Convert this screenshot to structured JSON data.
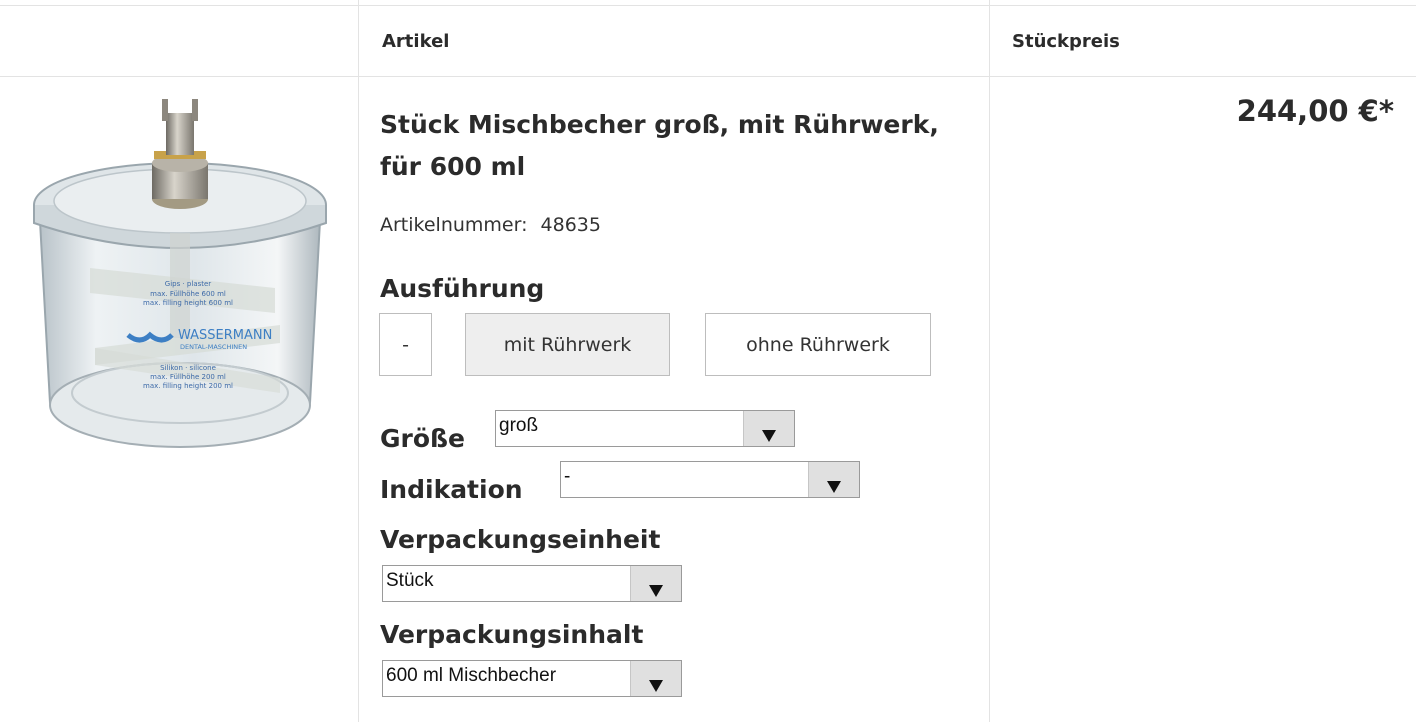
{
  "table": {
    "header_article": "Artikel",
    "header_unit_price": "Stückpreis"
  },
  "product": {
    "title": "Stück Mischbecher groß, mit Rührwerk, für 600 ml",
    "article_number_label": "Artikelnummer:",
    "article_number": "48635",
    "price": "244,00 €*",
    "image_icon": "mixing-beaker-product-image",
    "image_text": {
      "brand_line1": "WASSERMANN",
      "brand_line2": "DENTAL-MASCHINEN",
      "top_label_1": "Gips · plaster",
      "top_label_2": "max. Füllhöhe 600 ml",
      "top_label_3": "max. filling height 600 ml",
      "bottom_label_1": "Silikon · silicone",
      "bottom_label_2": "max. Füllhöhe 200 ml",
      "bottom_label_3": "max. filling height 200 ml"
    }
  },
  "options": {
    "ausfuehrung_label": "Ausführung",
    "ausfuehrung_buttons": [
      "-",
      "mit Rührwerk",
      "ohne Rührwerk"
    ],
    "ausfuehrung_selected": "mit Rührwerk",
    "groesse_label": "Größe",
    "groesse_value": "groß",
    "indikation_label": "Indikation",
    "indikation_value": "-",
    "verpackungseinheit_label": "Verpackungseinheit",
    "verpackungseinheit_value": "Stück",
    "verpackungsinhalt_label": "Verpackungsinhalt",
    "verpackungsinhalt_value": "600 ml Mischbecher"
  },
  "colors": {
    "border": "#e3e3e3",
    "text": "#2b2b2b",
    "active_button": "#eeeeee",
    "select_arrow_bg": "#e0e0e0"
  }
}
